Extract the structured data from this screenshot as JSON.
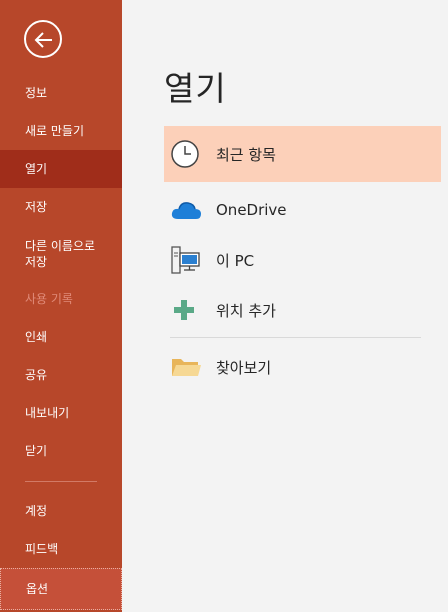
{
  "sidebar": {
    "items": [
      {
        "label": "정보"
      },
      {
        "label": "새로 만들기"
      },
      {
        "label": "열기"
      },
      {
        "label": "저장"
      },
      {
        "label": "다른 이름으로\n저장"
      },
      {
        "label": "사용 기록"
      },
      {
        "label": "인쇄"
      },
      {
        "label": "공유"
      },
      {
        "label": "내보내기"
      },
      {
        "label": "닫기"
      },
      {
        "label": "계정"
      },
      {
        "label": "피드백"
      },
      {
        "label": "옵션"
      }
    ],
    "colors": {
      "background": "#b7472a",
      "selected": "#a02d1a"
    }
  },
  "main": {
    "title": "열기",
    "options": [
      {
        "label": "최근 항목",
        "icon": "clock-icon"
      },
      {
        "label": "OneDrive",
        "icon": "cloud-icon"
      },
      {
        "label": "이 PC",
        "icon": "pc-icon"
      },
      {
        "label": "위치 추가",
        "icon": "plus-icon"
      },
      {
        "label": "찾아보기",
        "icon": "folder-icon"
      }
    ],
    "colors": {
      "selected": "#fcd0b9"
    }
  }
}
